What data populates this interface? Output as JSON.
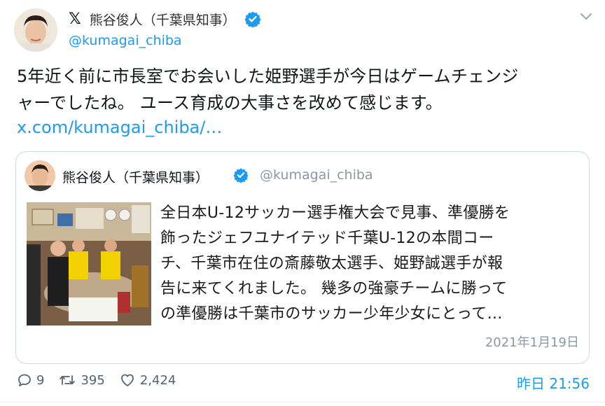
{
  "tweet": {
    "display_name": "熊谷俊人（千葉県知事）",
    "handle": "@kumagai_chiba",
    "platform_icon": "x-logo-icon",
    "text_line1": "5年近く前に市長室でお会いした姫野選手が今日はゲームチェンジ",
    "text_line2": "ャーでしたね。 ユース育成の大事さを改めて感じます。",
    "link": "x.com/kumagai_chiba/…"
  },
  "quote": {
    "display_name": "熊谷俊人（千葉県知事）",
    "handle": "@kumagai_chiba",
    "lines": [
      "全日本U-12サッカー選手権大会で見事、準優勝を",
      "飾ったジェフユナイテッド千葉U-12の本間コー",
      "チ、千葉市在住の斎藤敬太選手、姫野誠選手が報",
      "告に来てくれました。 幾多の強豪チームに勝って",
      "の準優勝は千葉市のサッカー少年少女にとって…"
    ],
    "date": "2021年1月19日"
  },
  "footer": {
    "replies": "9",
    "retweets": "395",
    "likes": "2,424",
    "time": "昨日 21:56"
  },
  "colors": {
    "accent": "#1d9bf0",
    "text": "#0f1419",
    "muted": "#536471",
    "border": "#cfd9de"
  }
}
